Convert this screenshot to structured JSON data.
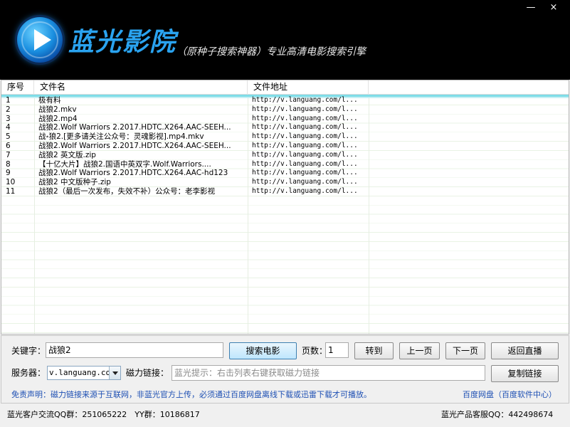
{
  "window": {
    "minimize_glyph": "—",
    "close_glyph": "×"
  },
  "header": {
    "brand_name": "蓝光影院",
    "subtitle": "（原种子搜索神器）专业高清电影搜索引擎",
    "logo_icon": "play-icon",
    "accent_color": "#2aa3f0"
  },
  "list": {
    "columns": [
      "序号",
      "文件名",
      "文件地址",
      ""
    ],
    "rows": [
      {
        "index": "1",
        "name": "极有料",
        "url": "http://v.languang.com/l..."
      },
      {
        "index": "2",
        "name": "战狼2.mkv",
        "url": "http://v.languang.com/l..."
      },
      {
        "index": "3",
        "name": "战狼2.mp4",
        "url": "http://v.languang.com/l..."
      },
      {
        "index": "4",
        "name": "战狼2.Wolf Warriors 2.2017.HDTC.X264.AAC-SEEH...",
        "url": "http://v.languang.com/l..."
      },
      {
        "index": "5",
        "name": "战⹈狼2.[更多请关注公众号：灵魂影视].mp4.mkv",
        "url": "http://v.languang.com/l..."
      },
      {
        "index": "6",
        "name": "战狼2.Wolf Warriors 2.2017.HDTC.X264.AAC-SEEH...",
        "url": "http://v.languang.com/l..."
      },
      {
        "index": "7",
        "name": "战狼2 英文版.zip",
        "url": "http://v.languang.com/l..."
      },
      {
        "index": "8",
        "name": "【十亿大片】战狼2.国语中英双字.Wolf.Warriors....",
        "url": "http://v.languang.com/l..."
      },
      {
        "index": "9",
        "name": "战狼2.Wolf Warriors 2.2017.HDTC.X264.AAC-hd123",
        "url": "http://v.languang.com/l..."
      },
      {
        "index": "10",
        "name": "战狼2 中文版种子.zip",
        "url": "http://v.languang.com/l..."
      },
      {
        "index": "11",
        "name": "战狼2（最后一次发布，失效不补）公众号：老李影视",
        "url": "http://v.languang.com/l..."
      }
    ]
  },
  "controls": {
    "keyword_label": "关键字：",
    "keyword_value": "战狼2",
    "search_button": "搜索电影",
    "page_label": "页数：",
    "page_value": "1",
    "goto_button": "转到",
    "prev_button": "上一页",
    "next_button": "下一页",
    "live_button": "返回直播",
    "server_label": "服务器：",
    "server_value": "v.languang.com",
    "magnet_label": "磁力链接：",
    "magnet_placeholder": "蓝光提示：右击列表右键获取磁力链接",
    "copy_button": "复制链接",
    "notice": "免责声明：磁力链接来源于互联网，非蓝光官方上传，必须通过百度网盘离线下载或迅雷下载才可播放。",
    "netdisk_link": "百度网盘（百度软件中心）"
  },
  "status": {
    "left_text": "蓝光客户交流QQ群：251065222　YY群：10186817",
    "right_text": "蓝光产品客服QQ：442498674"
  }
}
